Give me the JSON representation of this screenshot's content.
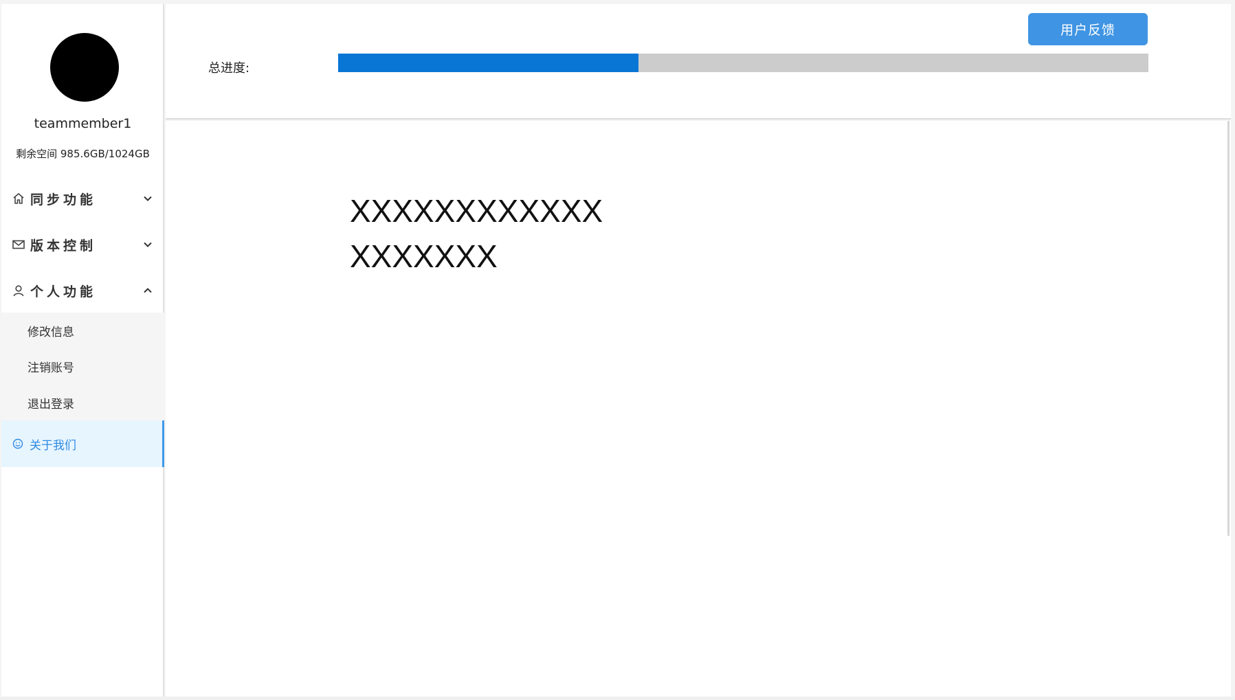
{
  "sidebar": {
    "username": "teammember1",
    "storage": "剩余空间 985.6GB/1024GB",
    "menu": [
      {
        "label": "同步功能",
        "icon": "home-icon",
        "expanded": false
      },
      {
        "label": "版本控制",
        "icon": "mail-icon",
        "expanded": false
      },
      {
        "label": "个人功能",
        "icon": "user-icon",
        "expanded": true
      }
    ],
    "submenu": [
      "修改信息",
      "注销账号",
      "退出登录"
    ],
    "about": {
      "label": "关于我们",
      "icon": "smile-icon",
      "active": true
    }
  },
  "header": {
    "feedback_button": "用户反馈",
    "progress_label": "总进度:",
    "progress": 0.371
  },
  "main": {
    "lines": [
      "XXXXXXXXXXXX",
      "XXXXXXX"
    ]
  },
  "colors": {
    "accent": "#3f94e3",
    "progress_fill": "#0976d6",
    "progress_track": "#cccccc",
    "active_bg": "#e7f5fe",
    "active_text": "#2f8ae3"
  }
}
